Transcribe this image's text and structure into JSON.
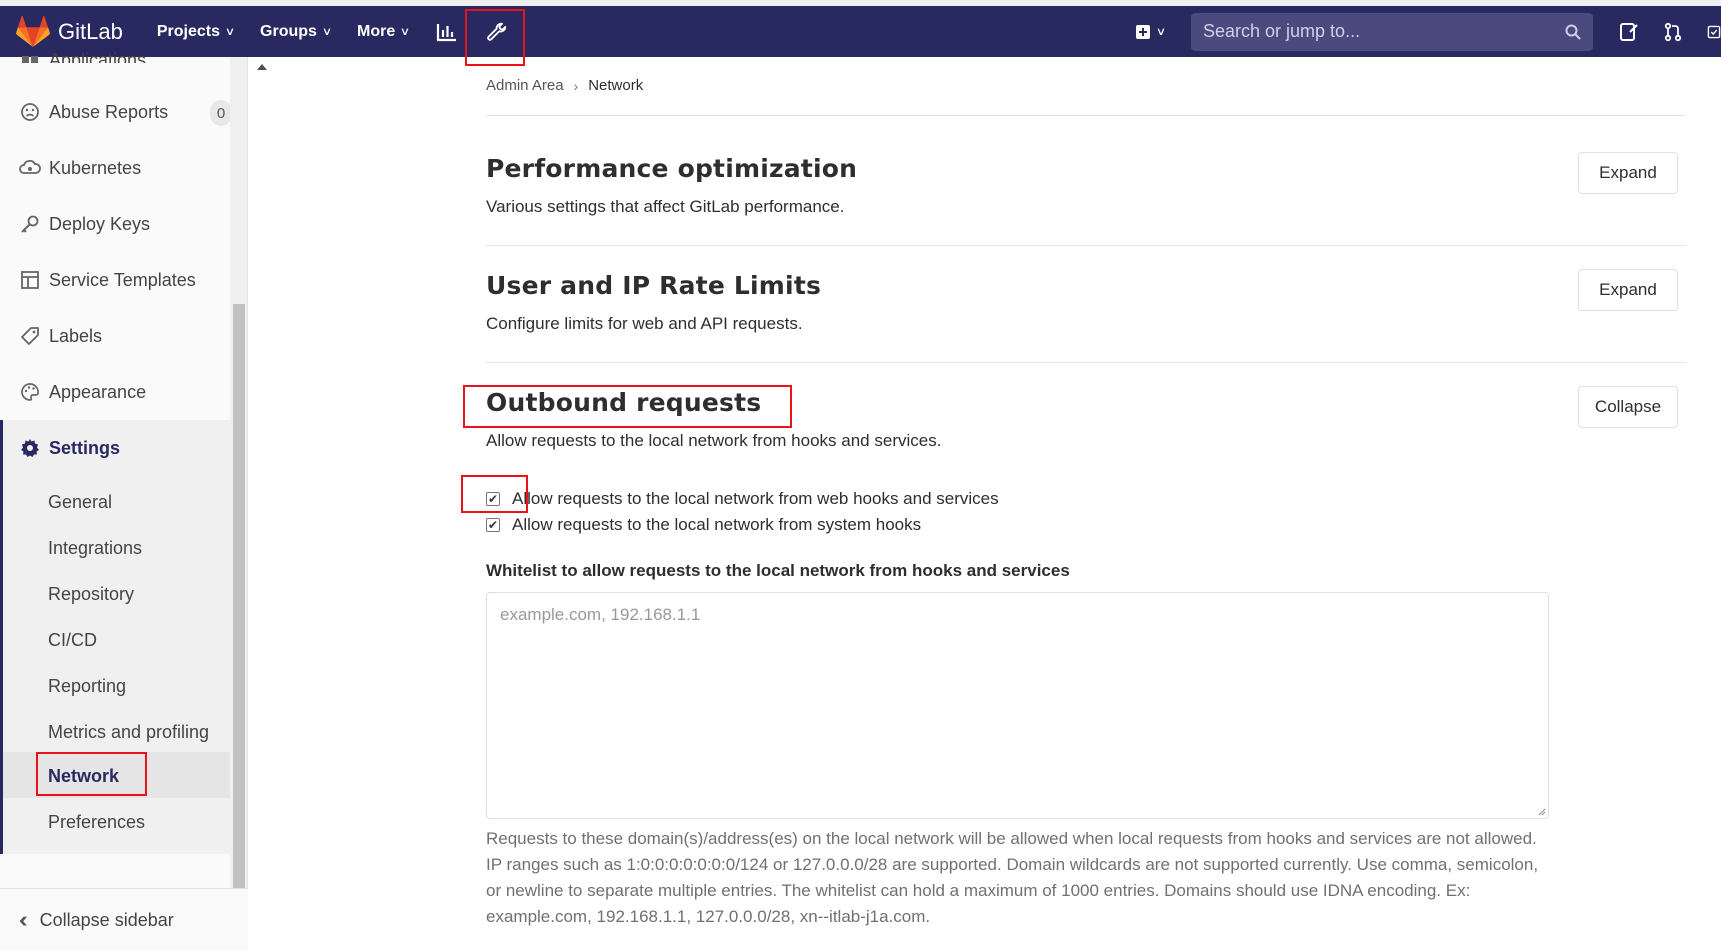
{
  "navbar": {
    "brand": "GitLab",
    "items": [
      {
        "label": "Projects"
      },
      {
        "label": "Groups"
      },
      {
        "label": "More"
      }
    ],
    "search_placeholder": "Search or jump to..."
  },
  "sidebar": {
    "partial_top_item": "Applications",
    "items": [
      {
        "label": "Abuse Reports",
        "badge": "0"
      },
      {
        "label": "Kubernetes"
      },
      {
        "label": "Deploy Keys"
      },
      {
        "label": "Service Templates"
      },
      {
        "label": "Labels"
      },
      {
        "label": "Appearance"
      },
      {
        "label": "Settings"
      }
    ],
    "settings_sub": [
      {
        "label": "General"
      },
      {
        "label": "Integrations"
      },
      {
        "label": "Repository"
      },
      {
        "label": "CI/CD"
      },
      {
        "label": "Reporting"
      },
      {
        "label": "Metrics and profiling"
      },
      {
        "label": "Network"
      },
      {
        "label": "Preferences"
      }
    ],
    "collapse_label": "Collapse sidebar"
  },
  "breadcrumb": {
    "parent": "Admin Area",
    "current": "Network"
  },
  "sections": [
    {
      "title": "Performance optimization",
      "desc": "Various settings that affect GitLab performance.",
      "button": "Expand"
    },
    {
      "title": "User and IP Rate Limits",
      "desc": "Configure limits for web and API requests.",
      "button": "Expand"
    },
    {
      "title": "Outbound requests",
      "desc": "Allow requests to the local network from hooks and services.",
      "button": "Collapse"
    }
  ],
  "outbound": {
    "checkbox1": {
      "label": "Allow requests to the local network from web hooks and services",
      "checked": true
    },
    "checkbox2": {
      "label": "Allow requests to the local network from system hooks",
      "checked": true
    },
    "whitelist_label": "Whitelist to allow requests to the local network from hooks and services",
    "whitelist_placeholder": "example.com, 192.168.1.1",
    "help_text": "Requests to these domain(s)/address(es) on the local network will be allowed when local requests from hooks and services are not allowed. IP ranges such as 1:0:0:0:0:0:0:0/124 or 127.0.0.0/28 are supported. Domain wildcards are not supported currently. Use comma, semicolon, or newline to separate multiple entries. The whitelist can hold a maximum of 1000 entries. Domains should use IDNA encoding. Ex: example.com, 192.168.1.1, 127.0.0.0/28, xn--itlab-j1a.com."
  },
  "colors": {
    "navbar": "#292961",
    "highlight": "#e8141a",
    "active_border": "#292961"
  }
}
